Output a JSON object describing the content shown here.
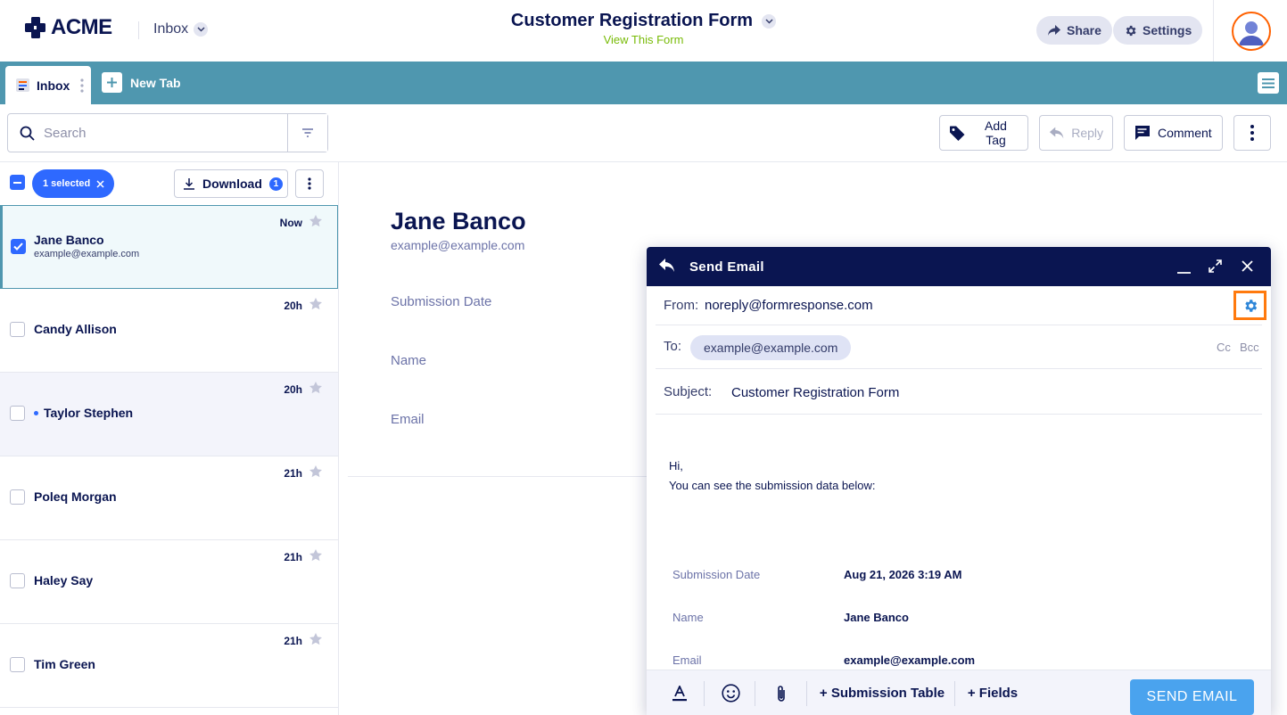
{
  "header": {
    "logo_text": "ACME",
    "inbox_switch_label": "Inbox",
    "form_title": "Customer Registration Form",
    "view_form_link": "View This Form",
    "share_label": "Share",
    "settings_label": "Settings"
  },
  "tabs": {
    "active_tab_label": "Inbox",
    "new_tab_label": "New Tab"
  },
  "toolbar": {
    "search_placeholder": "Search",
    "add_tag_label": "Add Tag",
    "reply_label": "Reply",
    "comment_label": "Comment"
  },
  "list": {
    "selected_label": "1 selected",
    "download_label": "Download",
    "download_count": "1",
    "items": [
      {
        "name": "Jane Banco",
        "email": "example@example.com",
        "time": "Now",
        "selected": true
      },
      {
        "name": "Candy Allison",
        "time": "20h"
      },
      {
        "name": "Taylor Stephen",
        "time": "20h",
        "unread": true
      },
      {
        "name": "Poleq Morgan",
        "time": "21h"
      },
      {
        "name": "Haley Say",
        "time": "21h"
      },
      {
        "name": "Tim Green",
        "time": "21h"
      }
    ]
  },
  "detail": {
    "name": "Jane Banco",
    "email": "example@example.com",
    "labels": [
      "Submission Date",
      "Name",
      "Email"
    ]
  },
  "email_modal": {
    "title": "Send Email",
    "from_label": "From:",
    "from_value": "noreply@formresponse.com",
    "to_label": "To:",
    "to_chip": "example@example.com",
    "cc_label": "Cc",
    "bcc_label": "Bcc",
    "subject_label": "Subject:",
    "subject_value": "Customer Registration Form",
    "body_line1": "Hi,",
    "body_line2": "You can see the submission data below:",
    "table": [
      {
        "label": "Submission Date",
        "value": "Aug 21, 2026 3:19 AM"
      },
      {
        "label": "Name",
        "value": "Jane Banco"
      },
      {
        "label": "Email",
        "value": "example@example.com"
      }
    ],
    "footer": {
      "submission_table_label": "+ Submission Table",
      "fields_label": "+ Fields",
      "send_label": "SEND EMAIL"
    }
  },
  "colors": {
    "navy": "#0a1551",
    "tabbar": "#4f97af",
    "accent_blue": "#2e69ff",
    "send_button": "#4aa3ee",
    "highlight_orange": "#ff7a0e",
    "view_form_green": "#78bb07"
  }
}
